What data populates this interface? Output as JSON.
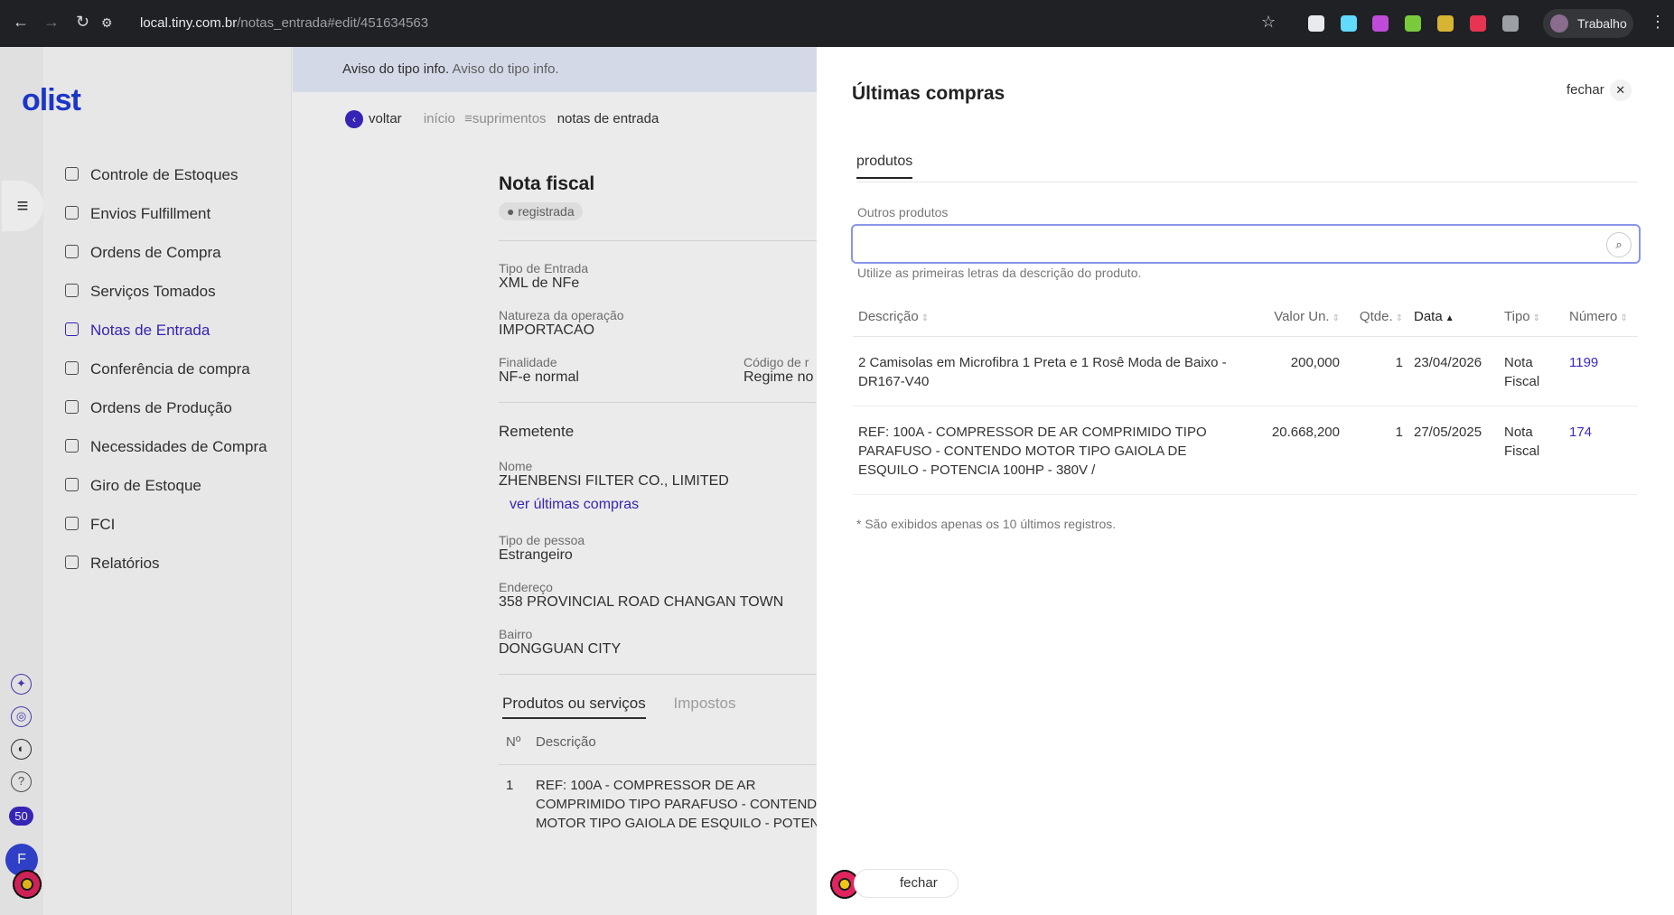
{
  "browser": {
    "url_host": "local.tiny.com.br",
    "url_path": "/notas_entrada#edit/451634563",
    "profile": "Trabalho"
  },
  "brand": {
    "logo": "olist",
    "accent": "#3b28c6"
  },
  "sidebar": {
    "items": [
      {
        "label": "Controle de Estoques",
        "icon": "grid-icon"
      },
      {
        "label": "Envios Fulfillment",
        "icon": "truck-icon"
      },
      {
        "label": "Ordens de Compra",
        "icon": "inbox-icon"
      },
      {
        "label": "Serviços Tomados",
        "icon": "document-icon"
      },
      {
        "label": "Notas de Entrada",
        "icon": "document-icon",
        "active": true
      },
      {
        "label": "Conferência de compra",
        "icon": "gift-icon"
      },
      {
        "label": "Ordens de Produção",
        "icon": "plug-icon"
      },
      {
        "label": "Necessidades de Compra",
        "icon": "clipboard-icon"
      },
      {
        "label": "Giro de Estoque",
        "icon": "refresh-icon"
      },
      {
        "label": "FCI",
        "icon": "inbox-icon"
      },
      {
        "label": "Relatórios",
        "icon": "report-icon"
      }
    ],
    "notif_count": "50",
    "user_initial": "F"
  },
  "alert": {
    "title": "Aviso do tipo info.",
    "text": "Aviso do tipo info."
  },
  "breadcrumb": {
    "back": "voltar",
    "items": [
      "início",
      "suprimentos"
    ],
    "current": "notas de entrada"
  },
  "invoice": {
    "title": "Nota fiscal",
    "status": "registrada",
    "tipo_entrada_label": "Tipo de Entrada",
    "tipo_entrada": "XML de NFe",
    "natureza_label": "Natureza da operação",
    "natureza": "IMPORTACAO",
    "finalidade_label": "Finalidade",
    "finalidade": "NF-e normal",
    "codigo_label": "Código de r",
    "codigo": "Regime no",
    "remetente_title": "Remetente",
    "nome_label": "Nome",
    "nome": "ZHENBENSI FILTER CO., LIMITED",
    "ver_ultimas": "ver últimas compras",
    "tipo_pessoa_label": "Tipo de pessoa",
    "tipo_pessoa": "Estrangeiro",
    "endereco_label": "Endereço",
    "endereco": "358 PROVINCIAL ROAD CHANGAN TOWN",
    "bairro_label": "Bairro",
    "bairro": "DONGGUAN CITY",
    "tab_products": "Produtos ou serviços",
    "tab_taxes": "Impostos",
    "col_n": "Nº",
    "col_desc": "Descrição",
    "row_n": "1",
    "row_desc": "REF: 100A - COMPRESSOR DE AR COMPRIMIDO TIPO PARAFUSO - CONTEND MOTOR TIPO GAIOLA DE ESQUILO - POTEN"
  },
  "drawer": {
    "title": "Últimas compras",
    "close": "fechar",
    "tab": "produtos",
    "input_label": "Outros produtos",
    "input_value": "",
    "hint": "Utilize as primeiras letras da descrição do produto.",
    "columns": [
      "Descrição",
      "Valor Un.",
      "Qtde.",
      "Data",
      "Tipo",
      "Número"
    ],
    "rows": [
      {
        "descricao": "2 Camisolas em Microfibra 1 Preta e 1 Rosê Moda de Baixo - DR167-V40",
        "valor": "200,000",
        "qtde": "1",
        "data": "23/04/2026",
        "tipo": "Nota Fiscal",
        "numero": "1199"
      },
      {
        "descricao": "REF: 100A - COMPRESSOR DE AR COMPRIMIDO TIPO PARAFUSO - CONTENDO MOTOR TIPO GAIOLA DE ESQUILO - POTENCIA 100HP - 380V /",
        "valor": "20.668,200",
        "qtde": "1",
        "data": "27/05/2025",
        "tipo": "Nota Fiscal",
        "numero": "174"
      }
    ],
    "footnote": "* São exibidos apenas os 10 últimos registros."
  },
  "bottom_close": "fechar"
}
